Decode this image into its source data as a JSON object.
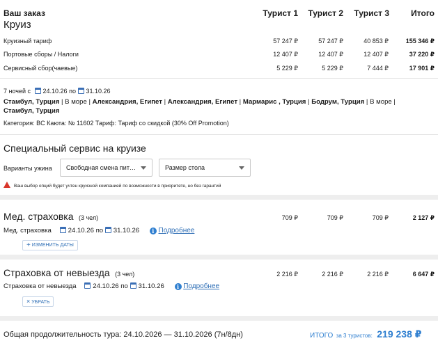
{
  "order": {
    "heading": "Ваш заказ",
    "subheading": "Круиз",
    "col_headers": [
      "Турист 1",
      "Турист 2",
      "Турист 3",
      "Итого"
    ],
    "rows": [
      {
        "label": "Круизный тариф",
        "values": [
          "57 247 ₽",
          "57 247 ₽",
          "40 853 ₽",
          "155 346 ₽"
        ]
      },
      {
        "label": "Портовые сборы / Налоги",
        "values": [
          "12 407 ₽",
          "12 407 ₽",
          "12 407 ₽",
          "37 220 ₽"
        ]
      },
      {
        "label": "Сервисный сбор(чаевые)",
        "values": [
          "5 229 ₽",
          "5 229 ₽",
          "7 444 ₽",
          "17 901 ₽"
        ]
      }
    ]
  },
  "cruise": {
    "nights": "7 ночей с",
    "date_from": "24.10.26",
    "po": "по",
    "date_to": "31.10.26",
    "route_line1": [
      {
        "text": "Стамбул, Турция",
        "bold": true
      },
      {
        "text": " | В море | ",
        "bold": false
      },
      {
        "text": "Александрия, Египет",
        "bold": true
      },
      {
        "text": " | ",
        "bold": false
      },
      {
        "text": "Александрия, Египет",
        "bold": true
      },
      {
        "text": " | ",
        "bold": false
      },
      {
        "text": "Мармарис , Турция",
        "bold": true
      },
      {
        "text": " | ",
        "bold": false
      },
      {
        "text": "Бодрум, Турция",
        "bold": true
      },
      {
        "text": " | В море |",
        "bold": false
      }
    ],
    "route_line2": "Стамбул, Турция",
    "details": "Категория: BC   Каюта: № 11602   Тариф: Тариф со скидкой (30% Off Promotion)"
  },
  "special": {
    "title": "Специальный сервис на круизе",
    "dinner_label": "Варианты ужина",
    "dinner_value": "Свободная смена пит…",
    "table_value": "Размер стола",
    "warning": "Ваш выбор опций будет учтен круизной компанией по возможности в приоритете, но без гарантий"
  },
  "med": {
    "title": "Мед. страховка",
    "count": "(3 чел)",
    "values": [
      "709 ₽",
      "709 ₽",
      "709 ₽",
      "2 127 ₽"
    ],
    "sub_label": "Мед. страховка",
    "date_from": "24.10.26",
    "po": "по",
    "date_to": "31.10.26",
    "more_link": "Подробнее",
    "change_btn": "ИЗМЕНИТЬ ДАТЫ"
  },
  "cancel": {
    "title": "Страховка от невыезда",
    "count": "(3 чел)",
    "values": [
      "2 216 ₽",
      "2 216 ₽",
      "2 216 ₽",
      "6 647 ₽"
    ],
    "sub_label": "Страховка от невыезда",
    "date_from": "24.10.26",
    "po": "по",
    "date_to": "31.10.26",
    "more_link": "Подробнее",
    "remove_btn": "УБРАТЬ"
  },
  "footer": {
    "duration": "Общая продолжительность тура: 24.10.2026 — 31.10.2026 (7н/8дн)",
    "total_label": "ИТОГО",
    "total_for": "за 3 туристов:",
    "total_value": "219 238 ₽"
  },
  "colors": {
    "accent": "#2f7fd0",
    "warning": "#d9362b",
    "total": "#2f7fd0"
  }
}
